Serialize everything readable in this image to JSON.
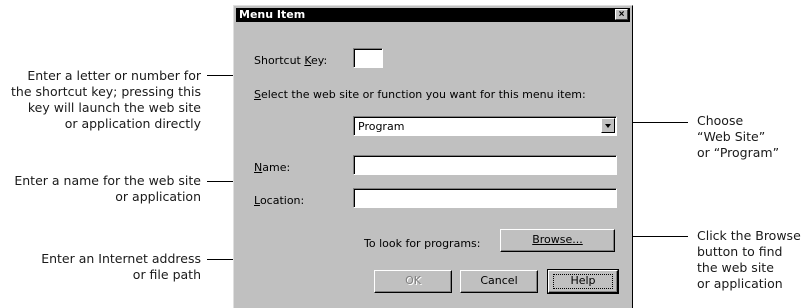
{
  "dialog": {
    "title": "Menu Item",
    "close_glyph": "×",
    "shortcut_label": "Shortcut Key:",
    "shortcut_value": "",
    "select_prompt": "Select the web site or function you want for this menu item:",
    "function_select": {
      "selected": "Program"
    },
    "name_label": "Name:",
    "name_value": "",
    "location_label": "Location:",
    "location_value": "",
    "browse_prompt": "To look for programs:",
    "browse_label": "Browse...",
    "ok_label": "OK",
    "cancel_label": "Cancel",
    "help_label": "Help"
  },
  "callouts": {
    "shortcut": [
      "Enter a letter or number for",
      "the shortcut key; pressing this",
      "key will launch the web site",
      "or application directly"
    ],
    "name": [
      "Enter a name for the web site",
      "or application"
    ],
    "location": [
      "Enter an Internet address",
      "or file path"
    ],
    "choose": [
      "Choose",
      "“Web Site”",
      "or “Program”"
    ],
    "browse": [
      "Click the Browse",
      "button to find",
      "the web site",
      "or application"
    ]
  },
  "icons": {
    "close": "close-icon",
    "dropdown": "chevron-down-icon"
  }
}
